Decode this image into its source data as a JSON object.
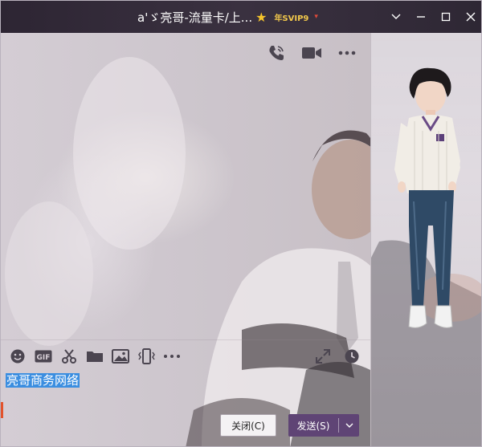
{
  "window": {
    "title": "a'ゞ亮哥-流量卡/上...",
    "vip_badge": "年SVIP9",
    "controls": {
      "dropdown": "chevron-down-icon",
      "minimize": "minimize-icon",
      "maximize": "maximize-icon",
      "close": "close-icon"
    }
  },
  "toolbar_top": {
    "icons": [
      "phone-call-icon",
      "video-call-icon",
      "more-icon"
    ]
  },
  "input_toolbar": {
    "icons": [
      "emoji-icon",
      "gif-icon",
      "screenshot-scissors-icon",
      "folder-icon",
      "image-icon",
      "shake-icon",
      "more-icon"
    ],
    "right_icons": [
      "expand-icon",
      "history-clock-icon"
    ]
  },
  "message_input": {
    "text": "亮哥商务网络"
  },
  "buttons": {
    "close_label": "关闭(C)",
    "send_label": "发送(S)"
  },
  "colors": {
    "titlebar": "#2d2533",
    "send_button": "#5f4475",
    "selection": "#3b8ee0",
    "star": "#f6c42b"
  }
}
